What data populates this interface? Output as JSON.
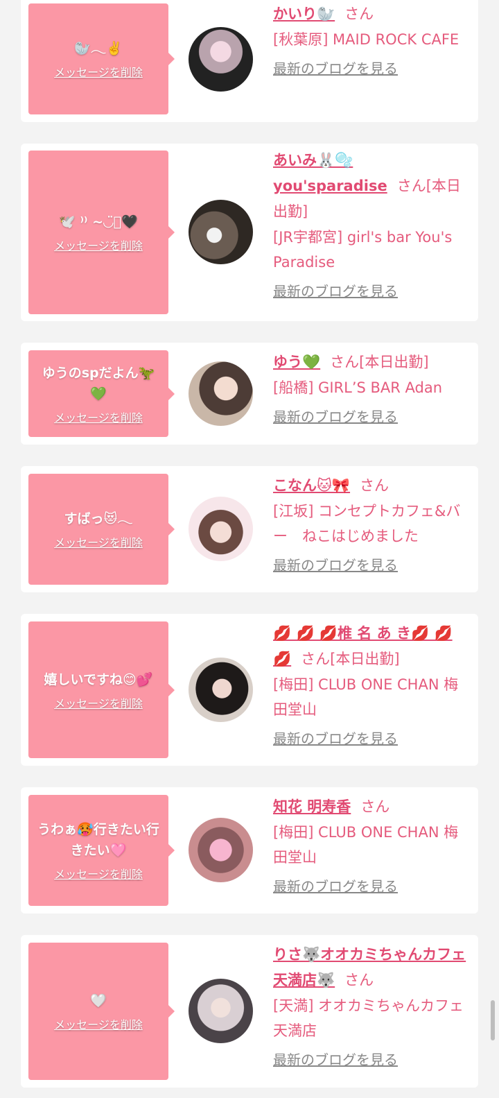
{
  "common": {
    "delete_label": "メッセージを削除",
    "san": "さん",
    "blog_label": "最新のブログを見る"
  },
  "items": [
    {
      "message": "🦭𓂃✌️",
      "name": "かいり🦭",
      "suffix": "",
      "shop": "[秋葉原] MAID ROCK CAFE"
    },
    {
      "message": "🕊️ ⁾⁾ ~◡̈⃝🖤",
      "name": "あいみ🐰🫧 you'sparadise",
      "suffix": "[本日出勤]",
      "shop": "[JR宇都宮] girl's bar You's Paradise"
    },
    {
      "message": "ゆうのspだよん🦖💚",
      "name": "ゆう💚",
      "suffix": "[本日出勤]",
      "shop": "[船橋] GIRL’S BAR Adan"
    },
    {
      "message": "すばっ😻𓂃",
      "name": "こなん🐱🎀",
      "suffix": "",
      "shop": "[江坂] コンセプトカフェ&バー　ねこはじめました"
    },
    {
      "message": "嬉しいですね😊💕",
      "name": "💋 💋 💋椎 名 あ き💋 💋 💋",
      "suffix": "[本日出勤]",
      "shop": "[梅田] CLUB ONE CHAN 梅田堂山"
    },
    {
      "message": "うわぁ🥵行きたい行きたい🩷",
      "name": "知花 明寿香",
      "suffix": "",
      "shop": "[梅田] CLUB ONE CHAN 梅田堂山"
    },
    {
      "message": "🤍",
      "name": "りさ🐺オオカミちゃんカフェ天満店🐺",
      "suffix": "",
      "shop": "[天満] オオカミちゃんカフェ天満店"
    }
  ]
}
